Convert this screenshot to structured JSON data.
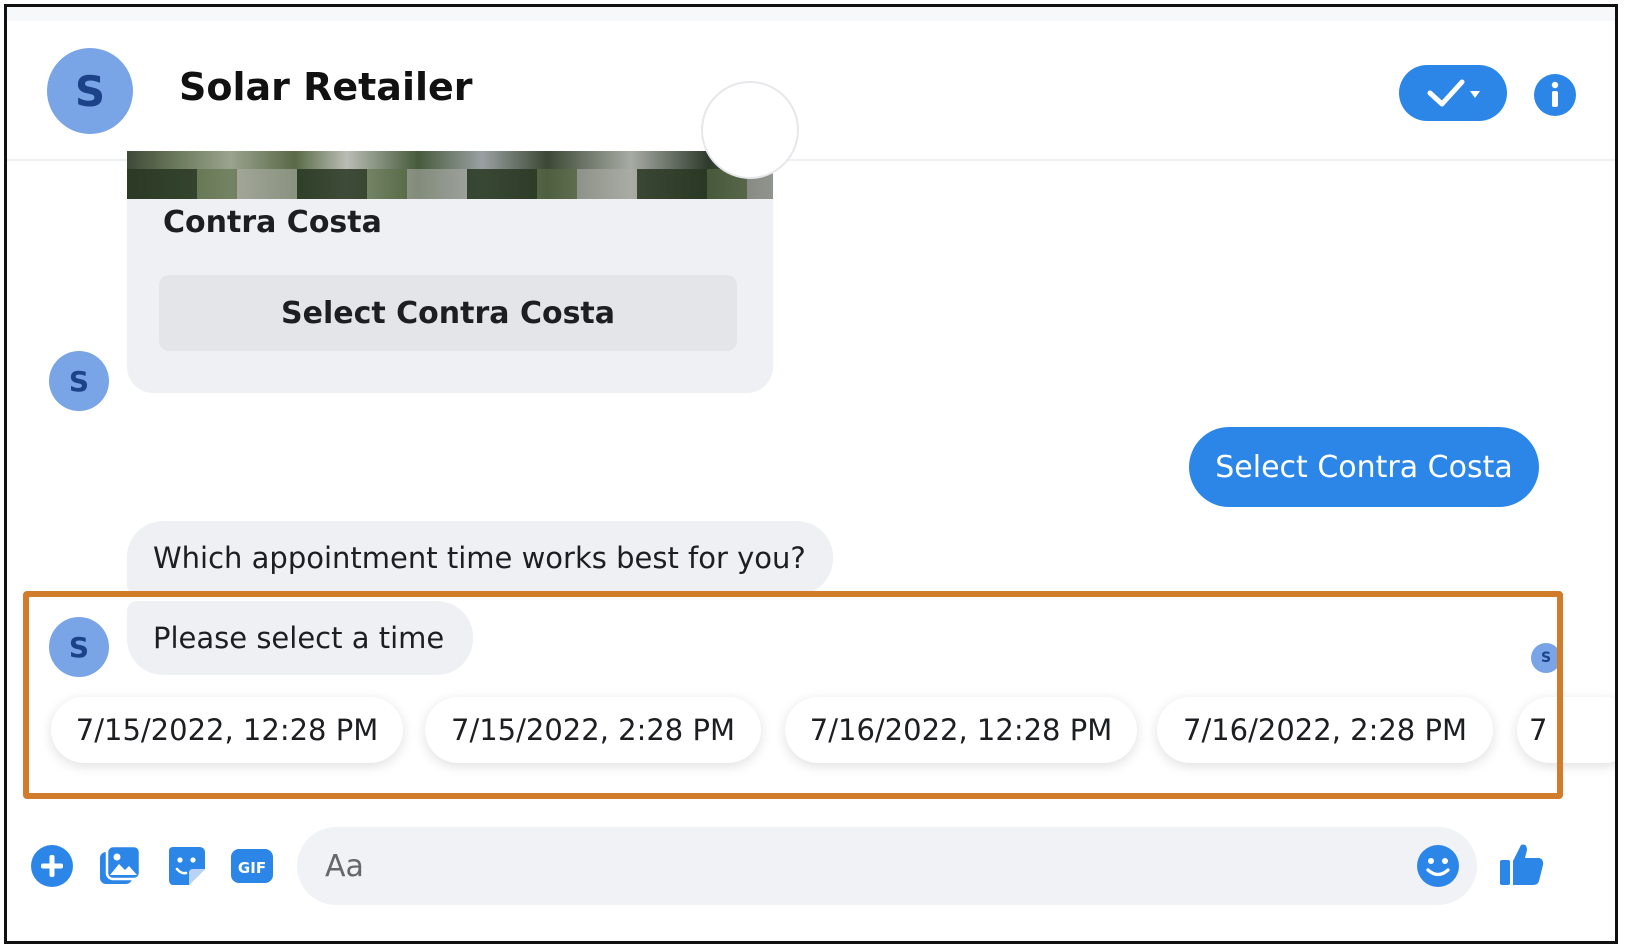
{
  "header": {
    "avatar_initial": "S",
    "title": "Solar Retailer"
  },
  "card": {
    "title": "Contra Costa",
    "button_label": "Select Contra Costa"
  },
  "messages": {
    "sender_initial": "S",
    "outgoing": "Select Contra Costa",
    "incoming_question": "Which appointment time works best for you?",
    "incoming_prompt": "Please select a time",
    "seen_initial": "S"
  },
  "quick_replies": [
    "7/15/2022, 12:28 PM",
    "7/15/2022, 2:28 PM",
    "7/16/2022, 12:28 PM",
    "7/16/2022, 2:28 PM",
    "7"
  ],
  "composer": {
    "placeholder": "Aa"
  },
  "icons": {
    "status": "check-dropdown-icon",
    "info": "info-icon",
    "add": "plus-circle-icon",
    "gallery": "image-gallery-icon",
    "sticker": "sticker-icon",
    "gif": "gif-icon",
    "emoji": "smiley-icon",
    "like": "thumbs-up-icon"
  },
  "colors": {
    "accent": "#2c86e8",
    "avatar_bg": "#79a4e6",
    "bubble_bg": "#eef0f3",
    "highlight": "#d07c2a"
  }
}
